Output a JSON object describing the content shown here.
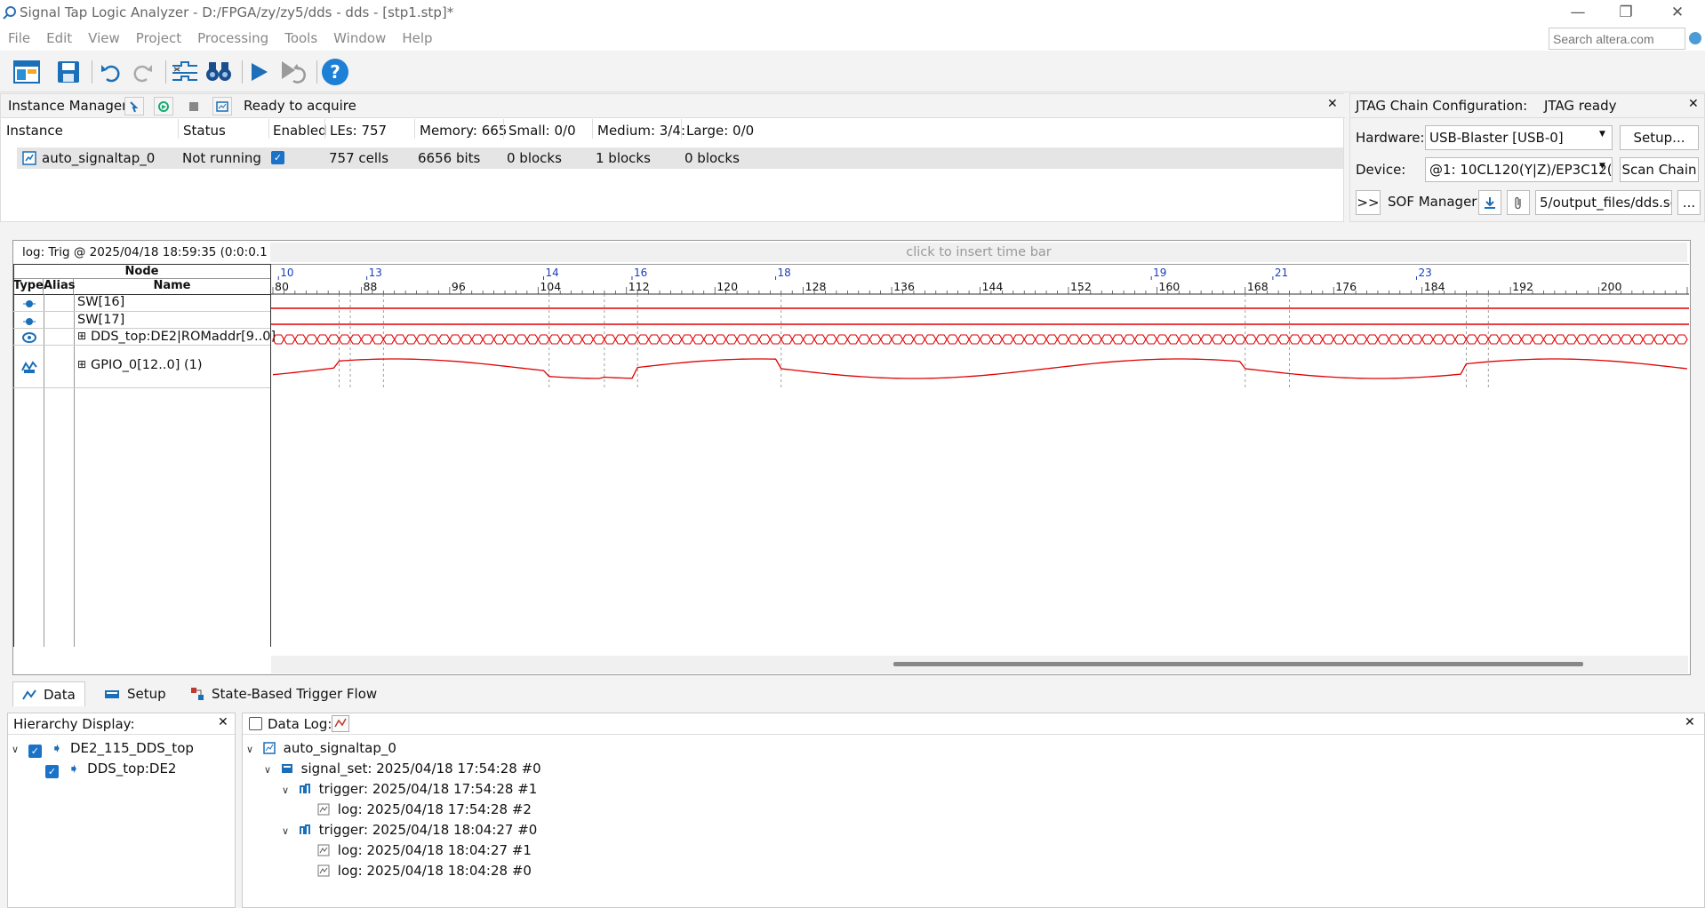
{
  "window": {
    "title": "Signal Tap Logic Analyzer - D:/FPGA/zy/zy5/dds - dds - [stp1.stp]*",
    "controls": [
      "—",
      "❐",
      "✕"
    ]
  },
  "menu": [
    "File",
    "Edit",
    "View",
    "Project",
    "Processing",
    "Tools",
    "Window",
    "Help"
  ],
  "search": {
    "placeholder": "Search altera.com"
  },
  "toolbar": {
    "icons": [
      "instance-manager-icon",
      "save-icon",
      "undo-icon",
      "redo-icon",
      "node-finder-icon",
      "find-icon",
      "run-analysis-icon",
      "autorun-icon",
      "help-icon"
    ]
  },
  "instance_manager": {
    "label": "Instance Manager:",
    "status": "Ready to acquire",
    "close": "✕",
    "columns": [
      "Instance",
      "Status",
      "Enabled",
      "LEs: 757",
      "Memory: 665",
      "Small: 0/0",
      "Medium: 3/4:",
      "Large: 0/0"
    ],
    "row": {
      "instance": "auto_signaltap_0",
      "status": "Not running",
      "enabled": true,
      "les": "757 cells",
      "memory": "6656 bits",
      "small": "0 blocks",
      "medium": "1 blocks",
      "large": "0 blocks"
    }
  },
  "jtag": {
    "title": "JTAG Chain Configuration:",
    "status": "JTAG ready",
    "close": "✕",
    "hardware_label": "Hardware:",
    "hardware_value": "USB-Blaster [USB-0]",
    "setup_button": "Setup...",
    "device_label": "Device:",
    "device_value": "@1: 10CL120(Y|Z)/EP3C12(",
    "scan_button": "Scan Chain",
    "expand_button": ">>",
    "sof_label": "SOF Manager:",
    "sof_file": "5/output_files/dds.sof",
    "browse_button": "..."
  },
  "waveform": {
    "log_label": "log: Trig @ 2025/04/18 18:59:35 (0:0:0.1 elaps",
    "insert_time_bar": "click to insert time bar",
    "headers": {
      "node": "Node",
      "type": "Type",
      "alias": "Alias",
      "name": "Name"
    },
    "signals": [
      {
        "name": "SW[16]",
        "expand": ""
      },
      {
        "name": "SW[17]",
        "expand": ""
      },
      {
        "name": "DDS_top:DE2|ROMaddr[9..0]",
        "expand": "⊞"
      },
      {
        "name": "GPIO_0[12..0] (1)",
        "expand": "⊞"
      }
    ],
    "sample_labels": [
      "10",
      "13",
      "14",
      "16",
      "18",
      "19",
      "21",
      "23"
    ],
    "sample_label_positions": [
      80.5,
      88.5,
      104.5,
      112.5,
      125.5,
      159.5,
      170.5,
      183.5
    ],
    "ticks": [
      "80",
      "88",
      "96",
      "104",
      "112",
      "120",
      "128",
      "136",
      "144",
      "152",
      "160",
      "168",
      "176",
      "184",
      "192",
      "200",
      "208"
    ],
    "x_range": [
      80,
      208
    ],
    "dashed_marker_positions": [
      86,
      87,
      90,
      105,
      110,
      113,
      126,
      168,
      172,
      188,
      190
    ],
    "trace_color": "#e00000"
  },
  "tabs": [
    "Data",
    "Setup",
    "State-Based Trigger Flow"
  ],
  "hierarchy": {
    "title": "Hierarchy Display:",
    "close": "✕",
    "items": [
      {
        "label": "DE2_115_DDS_top",
        "checked": true
      },
      {
        "label": "DDS_top:DE2",
        "checked": true
      }
    ]
  },
  "data_log": {
    "title": "Data Log:",
    "close": "✕",
    "root": "auto_signaltap_0",
    "signal_set": "signal_set: 2025/04/18 17:54:28  #0",
    "trigger1": "trigger: 2025/04/18 17:54:28  #1",
    "log1": "log: 2025/04/18 17:54:28  #2",
    "trigger2": "trigger: 2025/04/18 18:04:27  #0",
    "log2": "log: 2025/04/18 18:04:27  #1",
    "log3": "log: 2025/04/18 18:04:28  #0"
  }
}
